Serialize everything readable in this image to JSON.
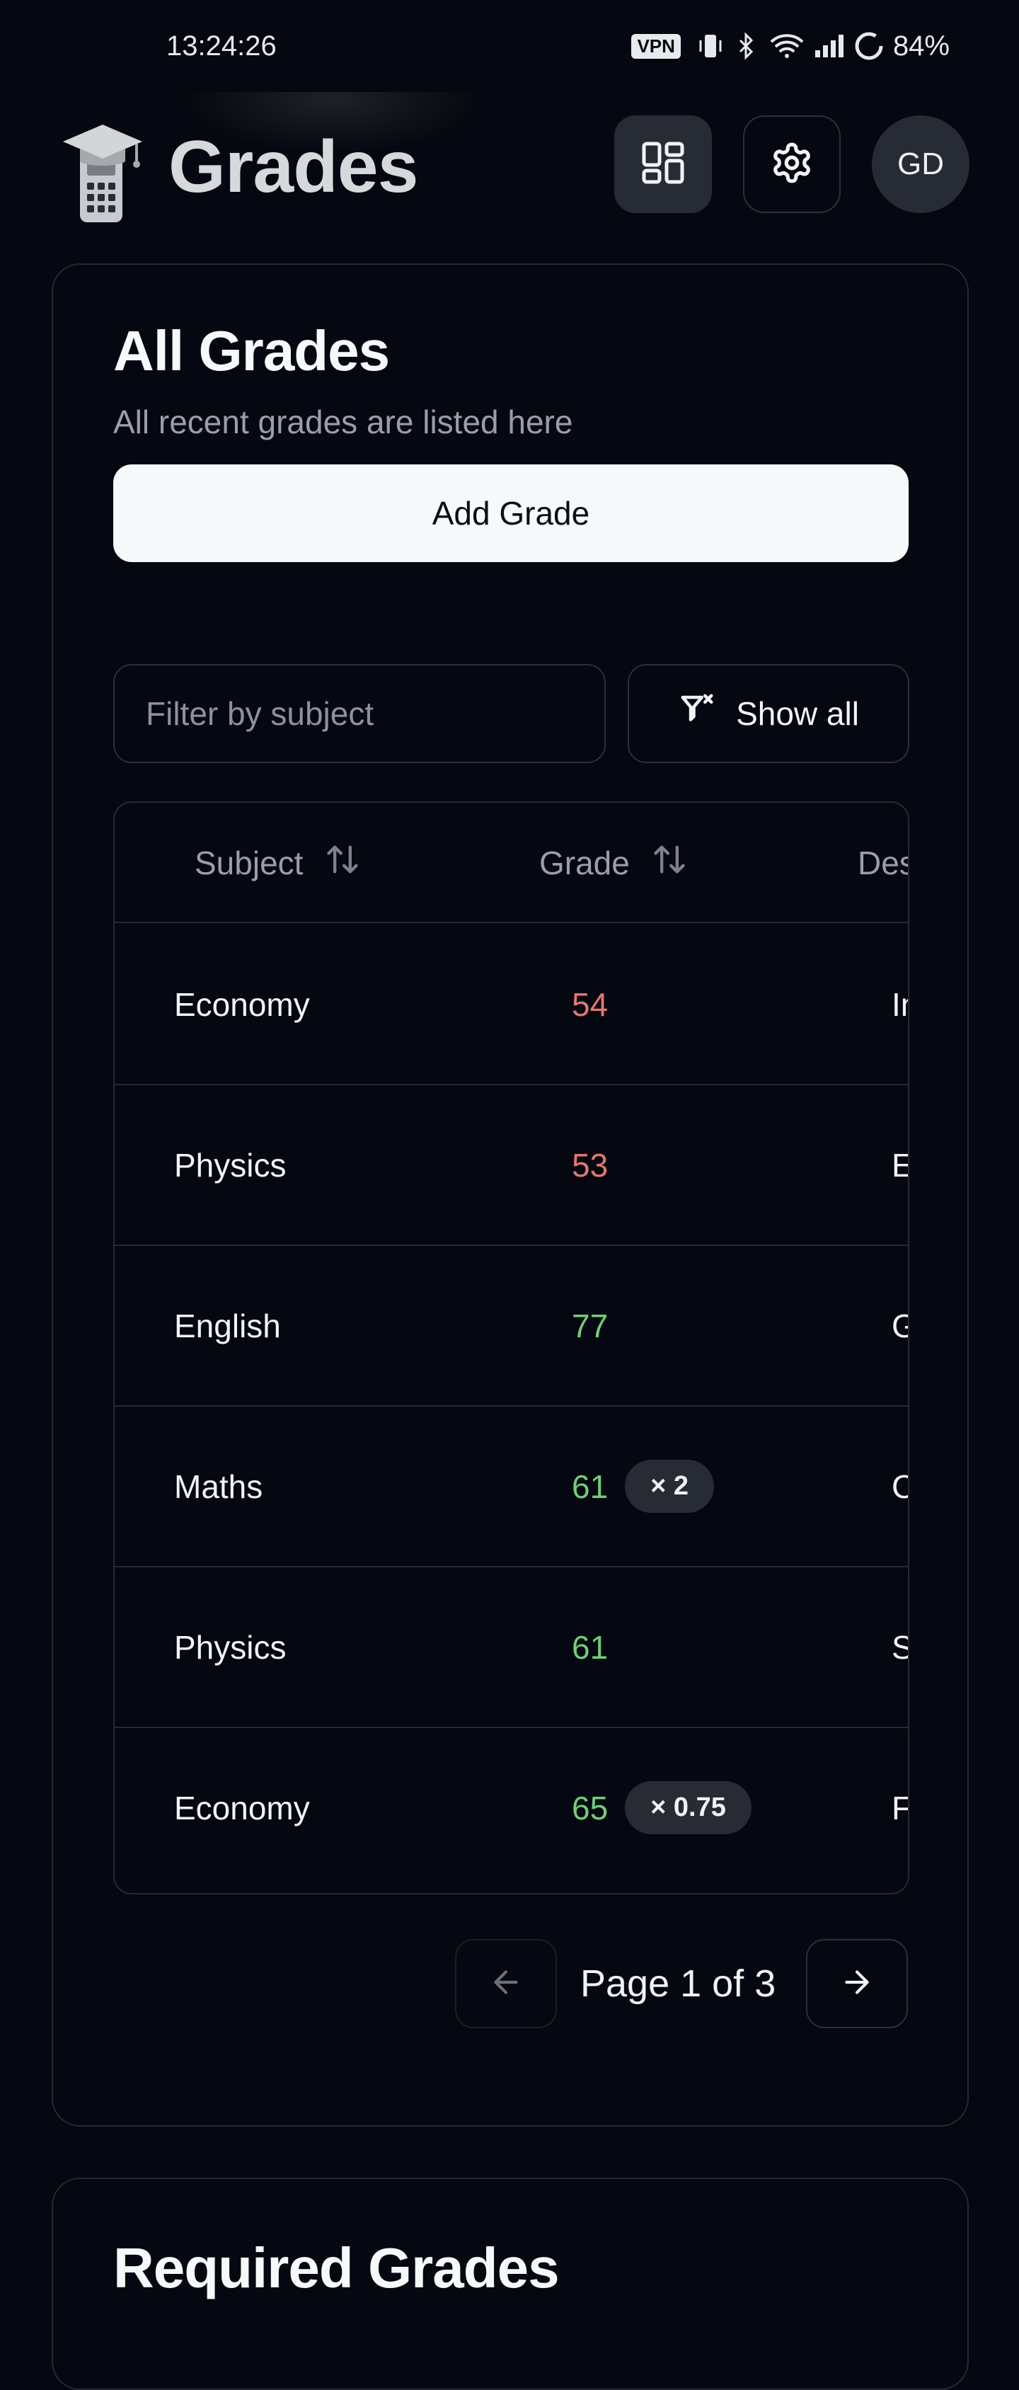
{
  "status_bar": {
    "time": "13:24:26",
    "vpn": "VPN",
    "battery": "84%"
  },
  "header": {
    "title": "Grades",
    "avatar_initials": "GD",
    "icons": [
      "graduation-calculator-logo",
      "dashboard-icon",
      "gear-icon"
    ]
  },
  "all_grades": {
    "title": "All Grades",
    "subtitle": "All recent grades are listed here",
    "add_button": "Add Grade",
    "filter_placeholder": "Filter by subject",
    "show_all": "Show all",
    "columns": [
      "Subject",
      "Grade",
      "Des"
    ],
    "rows": [
      {
        "subject": "Economy",
        "grade": "54",
        "status": "low",
        "weight": "",
        "description": "Inter"
      },
      {
        "subject": "Physics",
        "grade": "53",
        "status": "low",
        "weight": "",
        "description": "Ener"
      },
      {
        "subject": "English",
        "grade": "77",
        "status": "high",
        "weight": "",
        "description": "Gran"
      },
      {
        "subject": "Maths",
        "grade": "61",
        "status": "high",
        "weight": "× 2",
        "description": "Calc"
      },
      {
        "subject": "Physics",
        "grade": "61",
        "status": "high",
        "weight": "",
        "description": "Stati"
      },
      {
        "subject": "Economy",
        "grade": "65",
        "status": "high",
        "weight": "× 0.75",
        "description": "Fisca"
      }
    ],
    "pagination": "Page 1 of 3"
  },
  "required_grades": {
    "title": "Required Grades"
  },
  "colors": {
    "background": "#050810",
    "grade_low": "#e2776e",
    "grade_high": "#6fce79",
    "border": "#262a33"
  }
}
